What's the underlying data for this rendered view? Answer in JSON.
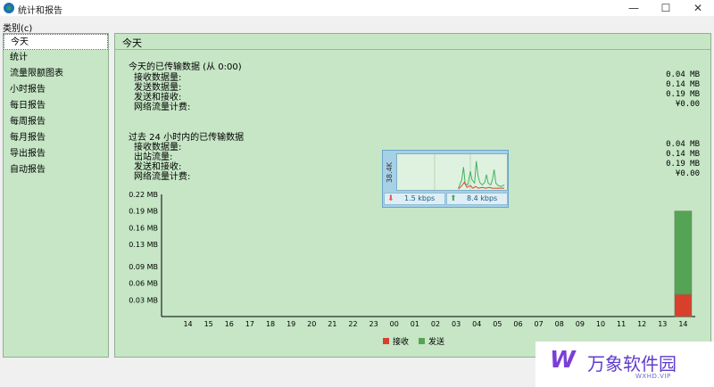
{
  "window": {
    "title": "统计和报告",
    "minimize_glyph": "—",
    "maximize_glyph": "☐",
    "close_glyph": "✕"
  },
  "category_label": "类别(c)",
  "sidebar": {
    "items": [
      {
        "label": "今天"
      },
      {
        "label": "统计"
      },
      {
        "label": "流量限额图表"
      },
      {
        "label": "小时报告"
      },
      {
        "label": "每日报告"
      },
      {
        "label": "每周报告"
      },
      {
        "label": "每月报告"
      },
      {
        "label": "导出报告"
      },
      {
        "label": "自动报告"
      }
    ],
    "selected": "今天"
  },
  "main": {
    "title": "今天",
    "today": {
      "title": "今天的已传输数据 (从 0:00)",
      "rows": [
        {
          "label": "接收数据量:",
          "value": "0.04 MB"
        },
        {
          "label": "发送数据量:",
          "value": "0.14 MB"
        },
        {
          "label": "发送和接收:",
          "value": "0.19 MB"
        },
        {
          "label": "网络流量计费:",
          "value": "¥0.00"
        }
      ]
    },
    "last24": {
      "title": "过去 24 小时内的已传输数据",
      "rows": [
        {
          "label": "接收数据量:",
          "value": "0.04 MB"
        },
        {
          "label": "出站流量:",
          "value": "0.14 MB"
        },
        {
          "label": "发送和接收:",
          "value": "0.19 MB"
        },
        {
          "label": "网络流量计费:",
          "value": "¥0.00"
        }
      ]
    }
  },
  "chart_data": {
    "type": "bar",
    "categories": [
      "14",
      "15",
      "16",
      "17",
      "18",
      "19",
      "20",
      "21",
      "22",
      "23",
      "00",
      "01",
      "02",
      "03",
      "04",
      "05",
      "06",
      "07",
      "08",
      "09",
      "10",
      "11",
      "12",
      "13",
      "14"
    ],
    "series": [
      {
        "name": "接收",
        "color": "#d9402b",
        "values": [
          0,
          0,
          0,
          0,
          0,
          0,
          0,
          0,
          0,
          0,
          0,
          0,
          0,
          0,
          0,
          0,
          0,
          0,
          0,
          0,
          0,
          0,
          0,
          0,
          0.04
        ]
      },
      {
        "name": "发送",
        "color": "#55a455",
        "values": [
          0,
          0,
          0,
          0,
          0,
          0,
          0,
          0,
          0,
          0,
          0,
          0,
          0,
          0,
          0,
          0,
          0,
          0,
          0,
          0,
          0,
          0,
          0,
          0,
          0.15
        ]
      }
    ],
    "stacked": true,
    "y_ticks": [
      "0.03 MB",
      "0.06 MB",
      "0.09 MB",
      "0.13 MB",
      "0.16 MB",
      "0.19 MB",
      "0.22 MB"
    ],
    "ylim": [
      0,
      0.22
    ],
    "legend_position": "bottom"
  },
  "widget": {
    "scale_label": "38.4K",
    "download": {
      "arrow": "⬇",
      "value": "1.5 kbps",
      "color": "#e05a5a"
    },
    "upload": {
      "arrow": "⬆",
      "value": "8.4 kbps",
      "color": "#3fae5f"
    }
  },
  "watermark": {
    "logo": "W",
    "text": "万象软件园",
    "sub": "WXHD.VIP"
  }
}
